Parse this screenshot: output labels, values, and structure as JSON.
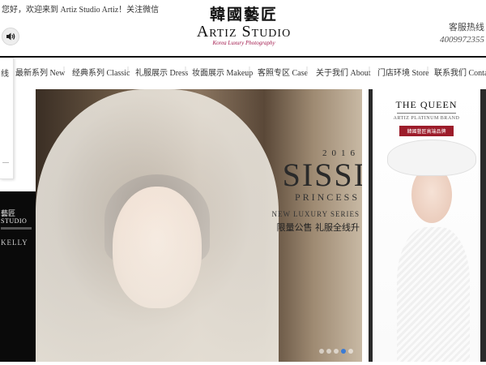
{
  "header": {
    "welcome": "您好，欢迎来到 Artiz Studio Artiz！关注微信",
    "logo_cn": "韓國藝匠",
    "logo_en": "Artiz Studio",
    "logo_sub": "Korea Luxury Photography",
    "hotline_label": "客服热线",
    "hotline_number": "4009972355"
  },
  "nav": {
    "items": [
      {
        "label": "最新系列 New"
      },
      {
        "label": "经典系列 Classic"
      },
      {
        "label": "礼服展示 Dress"
      },
      {
        "label": "妆面展示 Makeup"
      },
      {
        "label": "客照专区 Case"
      },
      {
        "label": "关于我们 About"
      },
      {
        "label": "门店环境 Store"
      },
      {
        "label": "联系我们 Contact"
      }
    ],
    "separator": "|"
  },
  "left_panel": {
    "text": "线"
  },
  "prev_slide": {
    "logo_cn": "藝匠",
    "logo_en": "STUDIO",
    "name": "KELLY"
  },
  "hero": {
    "year": "2016",
    "title": "SISSI",
    "subtitle": "PRINCESS",
    "series": "NEW LUXURY SERIES",
    "promo": "限量公售 礼服全线升",
    "slide_count": 5,
    "active_slide": 4
  },
  "side_ad": {
    "title": "THE QUEEN",
    "subtitle": "ARTIZ PLATINUM BRAND",
    "badge": "韓國藝匠高端品牌"
  },
  "colors": {
    "accent": "#a0164a",
    "badge": "#9c1c2a",
    "dot_active": "#3a7bd5"
  }
}
